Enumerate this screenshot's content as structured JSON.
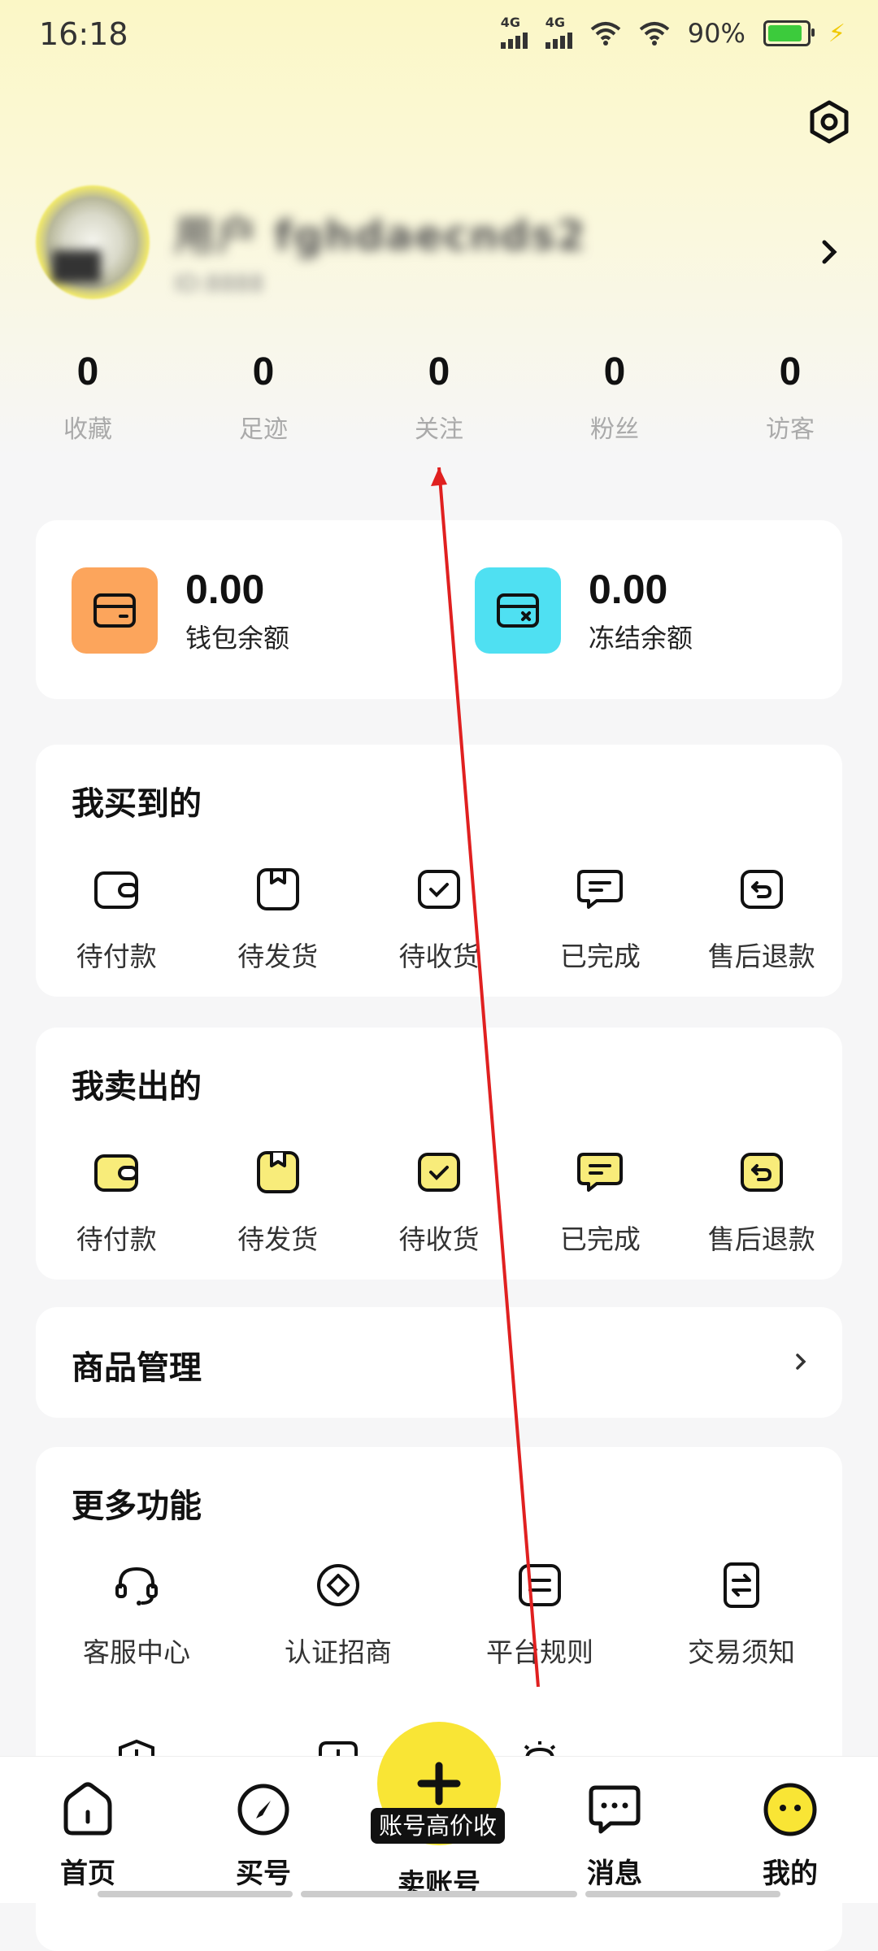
{
  "status_bar": {
    "time": "16:18",
    "signal1": "4G",
    "signal2": "4G",
    "battery_percent": "90%",
    "battery_level": 0.9
  },
  "profile": {
    "nickname": "用户 fghdaecnds2",
    "uid_text": "ID:8888"
  },
  "stats": [
    {
      "value": "0",
      "label": "收藏"
    },
    {
      "value": "0",
      "label": "足迹"
    },
    {
      "value": "0",
      "label": "关注"
    },
    {
      "value": "0",
      "label": "粉丝"
    },
    {
      "value": "0",
      "label": "访客"
    }
  ],
  "wallet": [
    {
      "amount": "0.00",
      "label": "钱包余额",
      "color": "#fca55c"
    },
    {
      "amount": "0.00",
      "label": "冻结余额",
      "color": "#4fe0f2"
    }
  ],
  "buy_section": {
    "title": "我买到的",
    "items": [
      "待付款",
      "待发货",
      "待收货",
      "已完成",
      "售后退款"
    ]
  },
  "sell_section": {
    "title": "我卖出的",
    "items": [
      "待付款",
      "待发货",
      "待收货",
      "已完成",
      "售后退款"
    ]
  },
  "goods": {
    "title": "商品管理"
  },
  "more_section": {
    "title": "更多功能",
    "items": [
      "客服中心",
      "认证招商",
      "平台规则",
      "交易须知"
    ]
  },
  "bottom_nav": {
    "home": "首页",
    "buy": "买号",
    "sell": "卖账号",
    "sell_tag": "账号高价收",
    "messages": "消息",
    "mine": "我的"
  },
  "colors": {
    "accent_yellow": "#f9e535",
    "annotation_red": "#e02020"
  }
}
